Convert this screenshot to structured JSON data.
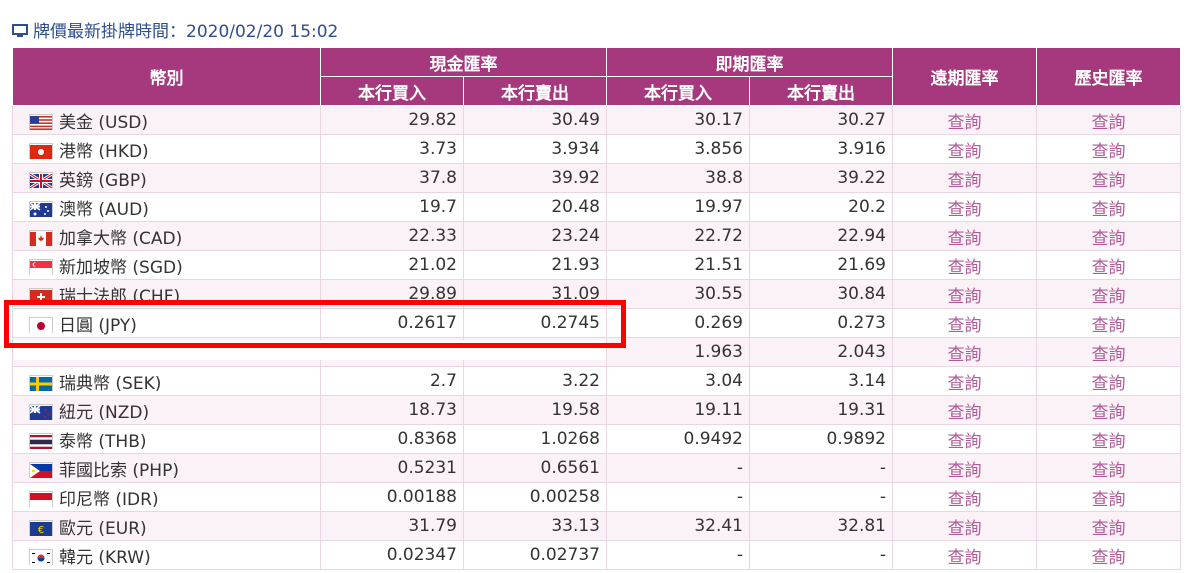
{
  "header": {
    "icon": "monitor-icon",
    "title": "牌價最新掛牌時間：2020/02/20 15:02"
  },
  "table": {
    "headers": {
      "currency": "幣別",
      "cash": "現金匯率",
      "spot": "即期匯率",
      "forward": "遠期匯率",
      "history": "歷史匯率",
      "buy": "本行買入",
      "sell": "本行賣出"
    },
    "rows": [
      {
        "flag": "us-flag-icon",
        "name": "美金 (USD)",
        "cash_buy": "29.82",
        "cash_sell": "30.49",
        "spot_buy": "30.17",
        "spot_sell": "30.27",
        "forward": "查詢",
        "history": "查詢"
      },
      {
        "flag": "hk-flag-icon",
        "name": "港幣 (HKD)",
        "cash_buy": "3.73",
        "cash_sell": "3.934",
        "spot_buy": "3.856",
        "spot_sell": "3.916",
        "forward": "查詢",
        "history": "查詢"
      },
      {
        "flag": "gb-flag-icon",
        "name": "英鎊 (GBP)",
        "cash_buy": "37.8",
        "cash_sell": "39.92",
        "spot_buy": "38.8",
        "spot_sell": "39.22",
        "forward": "查詢",
        "history": "查詢"
      },
      {
        "flag": "au-flag-icon",
        "name": "澳幣 (AUD)",
        "cash_buy": "19.7",
        "cash_sell": "20.48",
        "spot_buy": "19.97",
        "spot_sell": "20.2",
        "forward": "查詢",
        "history": "查詢"
      },
      {
        "flag": "ca-flag-icon",
        "name": "加拿大幣 (CAD)",
        "cash_buy": "22.33",
        "cash_sell": "23.24",
        "spot_buy": "22.72",
        "spot_sell": "22.94",
        "forward": "查詢",
        "history": "查詢"
      },
      {
        "flag": "sg-flag-icon",
        "name": "新加坡幣 (SGD)",
        "cash_buy": "21.02",
        "cash_sell": "21.93",
        "spot_buy": "21.51",
        "spot_sell": "21.69",
        "forward": "查詢",
        "history": "查詢"
      },
      {
        "flag": "ch-flag-icon",
        "name": "瑞士法郎 (CHF)",
        "cash_buy": "29.89",
        "cash_sell": "31.09",
        "spot_buy": "30.55",
        "spot_sell": "30.84",
        "forward": "查詢",
        "history": "查詢"
      },
      {
        "flag": "jp-flag-icon",
        "name": "日圓 (JPY)",
        "cash_buy": "0.2617",
        "cash_sell": "0.2745",
        "spot_buy": "0.269",
        "spot_sell": "0.273",
        "forward": "查詢",
        "history": "查詢"
      },
      {
        "flag": "za-flag-icon",
        "name": "",
        "cash_buy": "",
        "cash_sell": "",
        "spot_buy": "1.963",
        "spot_sell": "2.043",
        "forward": "查詢",
        "history": "查詢"
      },
      {
        "flag": "se-flag-icon",
        "name": "瑞典幣 (SEK)",
        "cash_buy": "2.7",
        "cash_sell": "3.22",
        "spot_buy": "3.04",
        "spot_sell": "3.14",
        "forward": "查詢",
        "history": "查詢"
      },
      {
        "flag": "nz-flag-icon",
        "name": "紐元 (NZD)",
        "cash_buy": "18.73",
        "cash_sell": "19.58",
        "spot_buy": "19.11",
        "spot_sell": "19.31",
        "forward": "查詢",
        "history": "查詢"
      },
      {
        "flag": "th-flag-icon",
        "name": "泰幣 (THB)",
        "cash_buy": "0.8368",
        "cash_sell": "1.0268",
        "spot_buy": "0.9492",
        "spot_sell": "0.9892",
        "forward": "查詢",
        "history": "查詢"
      },
      {
        "flag": "ph-flag-icon",
        "name": "菲國比索 (PHP)",
        "cash_buy": "0.5231",
        "cash_sell": "0.6561",
        "spot_buy": "-",
        "spot_sell": "-",
        "forward": "查詢",
        "history": "查詢"
      },
      {
        "flag": "id-flag-icon",
        "name": "印尼幣 (IDR)",
        "cash_buy": "0.00188",
        "cash_sell": "0.00258",
        "spot_buy": "-",
        "spot_sell": "-",
        "forward": "查詢",
        "history": "查詢"
      },
      {
        "flag": "eu-flag-icon",
        "name": "歐元 (EUR)",
        "cash_buy": "31.79",
        "cash_sell": "33.13",
        "spot_buy": "32.41",
        "spot_sell": "32.81",
        "forward": "查詢",
        "history": "查詢"
      },
      {
        "flag": "kr-flag-icon",
        "name": "韓元 (KRW)",
        "cash_buy": "0.02347",
        "cash_sell": "0.02737",
        "spot_buy": "-",
        "spot_sell": "-",
        "forward": "查詢",
        "history": "查詢"
      }
    ]
  },
  "highlight": {
    "color": "#ff0000",
    "row": "日圓 (JPY)"
  },
  "colors": {
    "header_bg": "#a6397d",
    "link": "#b15a96",
    "row_alt": "#fbf2f8",
    "title": "#2d4e8f"
  }
}
